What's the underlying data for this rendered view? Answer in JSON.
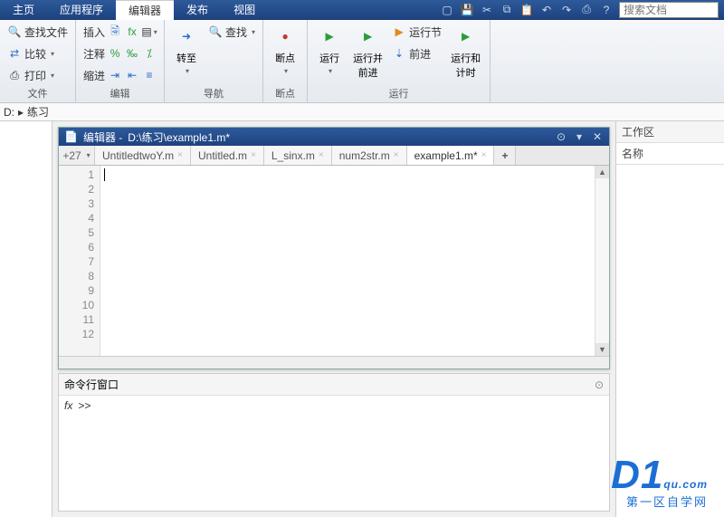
{
  "tabs": {
    "home": "主页",
    "apps": "应用程序",
    "editor": "编辑器",
    "publish": "发布",
    "view": "视图"
  },
  "search_placeholder": "搜索文档",
  "ribbon": {
    "file_group": "文件",
    "nav_group": "导航",
    "bp_group": "断点",
    "run_group": "运行",
    "find_files": "查找文件",
    "compare": "比较",
    "print": "打印",
    "insert": "插入",
    "comment": "注释",
    "indent": "缩进",
    "fx": "fx",
    "goto": "转至",
    "find": "查找",
    "breakpoints": "断点",
    "run": "运行",
    "run_advance": "运行并\n前进",
    "run_section": "运行节",
    "advance": "前进",
    "run_time": "运行和\n计时"
  },
  "addr": {
    "drive": "D:",
    "sep": "▸",
    "folder": "练习"
  },
  "workspace": {
    "title": "工作区",
    "col": "名称"
  },
  "editor": {
    "title_prefix": "编辑器 - ",
    "path": "D:\\练习\\example1.m*",
    "tabs": [
      "UntitledtwoY.m",
      "Untitled.m",
      "L_sinx.m",
      "num2str.m",
      "example1.m*"
    ],
    "active_tab": 4,
    "num_tab": "+27",
    "lines": [
      "1",
      "2",
      "3",
      "4",
      "5",
      "6",
      "7",
      "8",
      "9",
      "10",
      "11",
      "12"
    ]
  },
  "cmd": {
    "title": "命令行窗口",
    "fx": "fx",
    "prompt": ">>"
  },
  "watermark": {
    "brand": "D1",
    "domain": "qu.com",
    "sub": "第一区自学网"
  }
}
